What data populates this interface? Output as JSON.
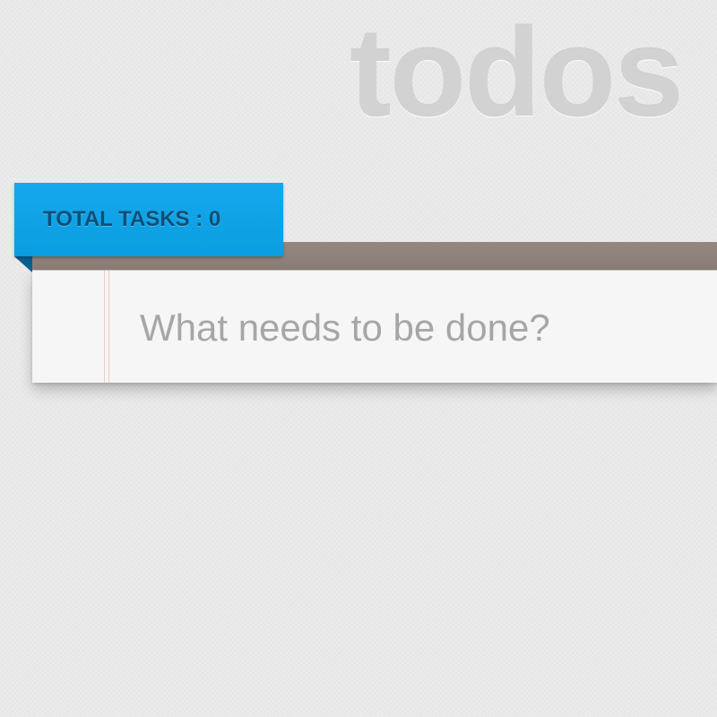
{
  "app": {
    "title": "todos"
  },
  "counter": {
    "label": "TOTAL TASKS : 0"
  },
  "new_todo": {
    "placeholder": "What needs to be done?",
    "value": ""
  },
  "colors": {
    "accent": "#0a9ddf",
    "header_bar": "#8f827c",
    "background": "#e9e9e9"
  }
}
